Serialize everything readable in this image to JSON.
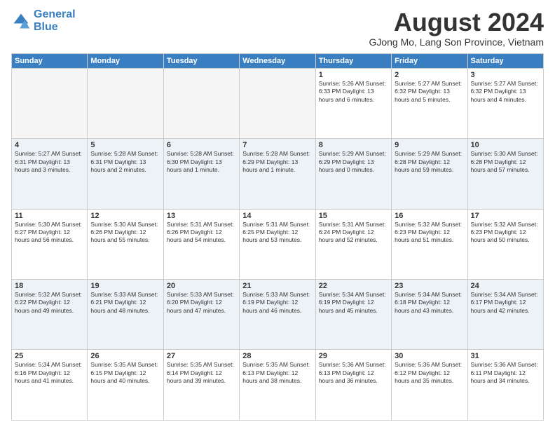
{
  "header": {
    "logo_line1": "General",
    "logo_line2": "Blue",
    "title": "August 2024",
    "subtitle": "GJong Mo, Lang Son Province, Vietnam"
  },
  "calendar": {
    "days_of_week": [
      "Sunday",
      "Monday",
      "Tuesday",
      "Wednesday",
      "Thursday",
      "Friday",
      "Saturday"
    ],
    "weeks": [
      [
        {
          "day": "",
          "info": "",
          "empty": true
        },
        {
          "day": "",
          "info": "",
          "empty": true
        },
        {
          "day": "",
          "info": "",
          "empty": true
        },
        {
          "day": "",
          "info": "",
          "empty": true
        },
        {
          "day": "1",
          "info": "Sunrise: 5:26 AM\nSunset: 6:33 PM\nDaylight: 13 hours\nand 6 minutes."
        },
        {
          "day": "2",
          "info": "Sunrise: 5:27 AM\nSunset: 6:32 PM\nDaylight: 13 hours\nand 5 minutes."
        },
        {
          "day": "3",
          "info": "Sunrise: 5:27 AM\nSunset: 6:32 PM\nDaylight: 13 hours\nand 4 minutes."
        }
      ],
      [
        {
          "day": "4",
          "info": "Sunrise: 5:27 AM\nSunset: 6:31 PM\nDaylight: 13 hours\nand 3 minutes."
        },
        {
          "day": "5",
          "info": "Sunrise: 5:28 AM\nSunset: 6:31 PM\nDaylight: 13 hours\nand 2 minutes."
        },
        {
          "day": "6",
          "info": "Sunrise: 5:28 AM\nSunset: 6:30 PM\nDaylight: 13 hours\nand 1 minute."
        },
        {
          "day": "7",
          "info": "Sunrise: 5:28 AM\nSunset: 6:29 PM\nDaylight: 13 hours\nand 1 minute."
        },
        {
          "day": "8",
          "info": "Sunrise: 5:29 AM\nSunset: 6:29 PM\nDaylight: 13 hours\nand 0 minutes."
        },
        {
          "day": "9",
          "info": "Sunrise: 5:29 AM\nSunset: 6:28 PM\nDaylight: 12 hours\nand 59 minutes."
        },
        {
          "day": "10",
          "info": "Sunrise: 5:30 AM\nSunset: 6:28 PM\nDaylight: 12 hours\nand 57 minutes."
        }
      ],
      [
        {
          "day": "11",
          "info": "Sunrise: 5:30 AM\nSunset: 6:27 PM\nDaylight: 12 hours\nand 56 minutes."
        },
        {
          "day": "12",
          "info": "Sunrise: 5:30 AM\nSunset: 6:26 PM\nDaylight: 12 hours\nand 55 minutes."
        },
        {
          "day": "13",
          "info": "Sunrise: 5:31 AM\nSunset: 6:26 PM\nDaylight: 12 hours\nand 54 minutes."
        },
        {
          "day": "14",
          "info": "Sunrise: 5:31 AM\nSunset: 6:25 PM\nDaylight: 12 hours\nand 53 minutes."
        },
        {
          "day": "15",
          "info": "Sunrise: 5:31 AM\nSunset: 6:24 PM\nDaylight: 12 hours\nand 52 minutes."
        },
        {
          "day": "16",
          "info": "Sunrise: 5:32 AM\nSunset: 6:23 PM\nDaylight: 12 hours\nand 51 minutes."
        },
        {
          "day": "17",
          "info": "Sunrise: 5:32 AM\nSunset: 6:23 PM\nDaylight: 12 hours\nand 50 minutes."
        }
      ],
      [
        {
          "day": "18",
          "info": "Sunrise: 5:32 AM\nSunset: 6:22 PM\nDaylight: 12 hours\nand 49 minutes."
        },
        {
          "day": "19",
          "info": "Sunrise: 5:33 AM\nSunset: 6:21 PM\nDaylight: 12 hours\nand 48 minutes."
        },
        {
          "day": "20",
          "info": "Sunrise: 5:33 AM\nSunset: 6:20 PM\nDaylight: 12 hours\nand 47 minutes."
        },
        {
          "day": "21",
          "info": "Sunrise: 5:33 AM\nSunset: 6:19 PM\nDaylight: 12 hours\nand 46 minutes."
        },
        {
          "day": "22",
          "info": "Sunrise: 5:34 AM\nSunset: 6:19 PM\nDaylight: 12 hours\nand 45 minutes."
        },
        {
          "day": "23",
          "info": "Sunrise: 5:34 AM\nSunset: 6:18 PM\nDaylight: 12 hours\nand 43 minutes."
        },
        {
          "day": "24",
          "info": "Sunrise: 5:34 AM\nSunset: 6:17 PM\nDaylight: 12 hours\nand 42 minutes."
        }
      ],
      [
        {
          "day": "25",
          "info": "Sunrise: 5:34 AM\nSunset: 6:16 PM\nDaylight: 12 hours\nand 41 minutes."
        },
        {
          "day": "26",
          "info": "Sunrise: 5:35 AM\nSunset: 6:15 PM\nDaylight: 12 hours\nand 40 minutes."
        },
        {
          "day": "27",
          "info": "Sunrise: 5:35 AM\nSunset: 6:14 PM\nDaylight: 12 hours\nand 39 minutes."
        },
        {
          "day": "28",
          "info": "Sunrise: 5:35 AM\nSunset: 6:13 PM\nDaylight: 12 hours\nand 38 minutes."
        },
        {
          "day": "29",
          "info": "Sunrise: 5:36 AM\nSunset: 6:13 PM\nDaylight: 12 hours\nand 36 minutes."
        },
        {
          "day": "30",
          "info": "Sunrise: 5:36 AM\nSunset: 6:12 PM\nDaylight: 12 hours\nand 35 minutes."
        },
        {
          "day": "31",
          "info": "Sunrise: 5:36 AM\nSunset: 6:11 PM\nDaylight: 12 hours\nand 34 minutes."
        }
      ]
    ]
  }
}
